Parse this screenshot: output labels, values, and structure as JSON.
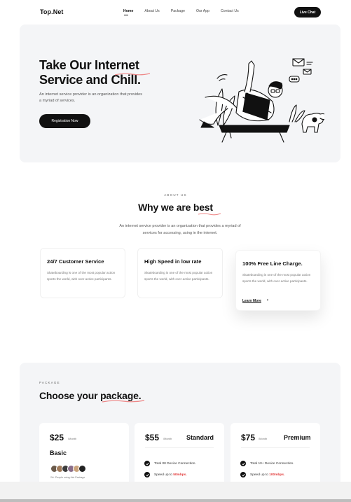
{
  "nav": {
    "logo": "Top.Net",
    "links": [
      "Home",
      "About Us",
      "Package",
      "Our App",
      "Contact Us"
    ],
    "cta": "Live Chat"
  },
  "hero": {
    "title_line1": "Take Our Internet",
    "title_line2": "Service and Chill.",
    "description": "An internet service provider  is an organization that provides a myriad of services.",
    "button": "Registration Now"
  },
  "about": {
    "eyebrow": "ABOUT US",
    "title_prefix": "Why we are ",
    "title_highlight": "best",
    "description": "An internet service provider  is an organization that provides a myriad of services for accessing, using in the internet.",
    "features": [
      {
        "title": "24/7 Customer Service",
        "text": "Skateboarding is one of the most popular action sports the world, with over active participants."
      },
      {
        "title": "High Speed in low rate",
        "text": "Skateboarding is one of the most popular action sports the world, with over active participants."
      },
      {
        "title": "100% Free Line Charge.",
        "text": "Skateboarding is one of the most popular action sports the world, with over active participants.",
        "link": "Learn More",
        "arrow": "›"
      }
    ]
  },
  "package": {
    "eyebrow": "PACKAGE",
    "title_prefix": "Choose your ",
    "title_highlight": "package",
    "title_suffix": ".",
    "plans": [
      {
        "price": "$25",
        "per": "/Month",
        "name": "Basic",
        "note": "2k+ People using this Package"
      },
      {
        "price": "$55",
        "per": "/Month",
        "name": "Standard",
        "features": [
          "Total 08 Device Connection.",
          "Speed up to "
        ],
        "speed": "50mbps."
      },
      {
        "price": "$75",
        "per": "/Month",
        "name": "Premium",
        "features": [
          "Total 10+ Device Connection.",
          "Speed up to "
        ],
        "speed": "100mbps."
      }
    ]
  },
  "colors": {
    "accent": "#e23b3b",
    "dark": "#111111",
    "panel": "#f4f5f7"
  }
}
